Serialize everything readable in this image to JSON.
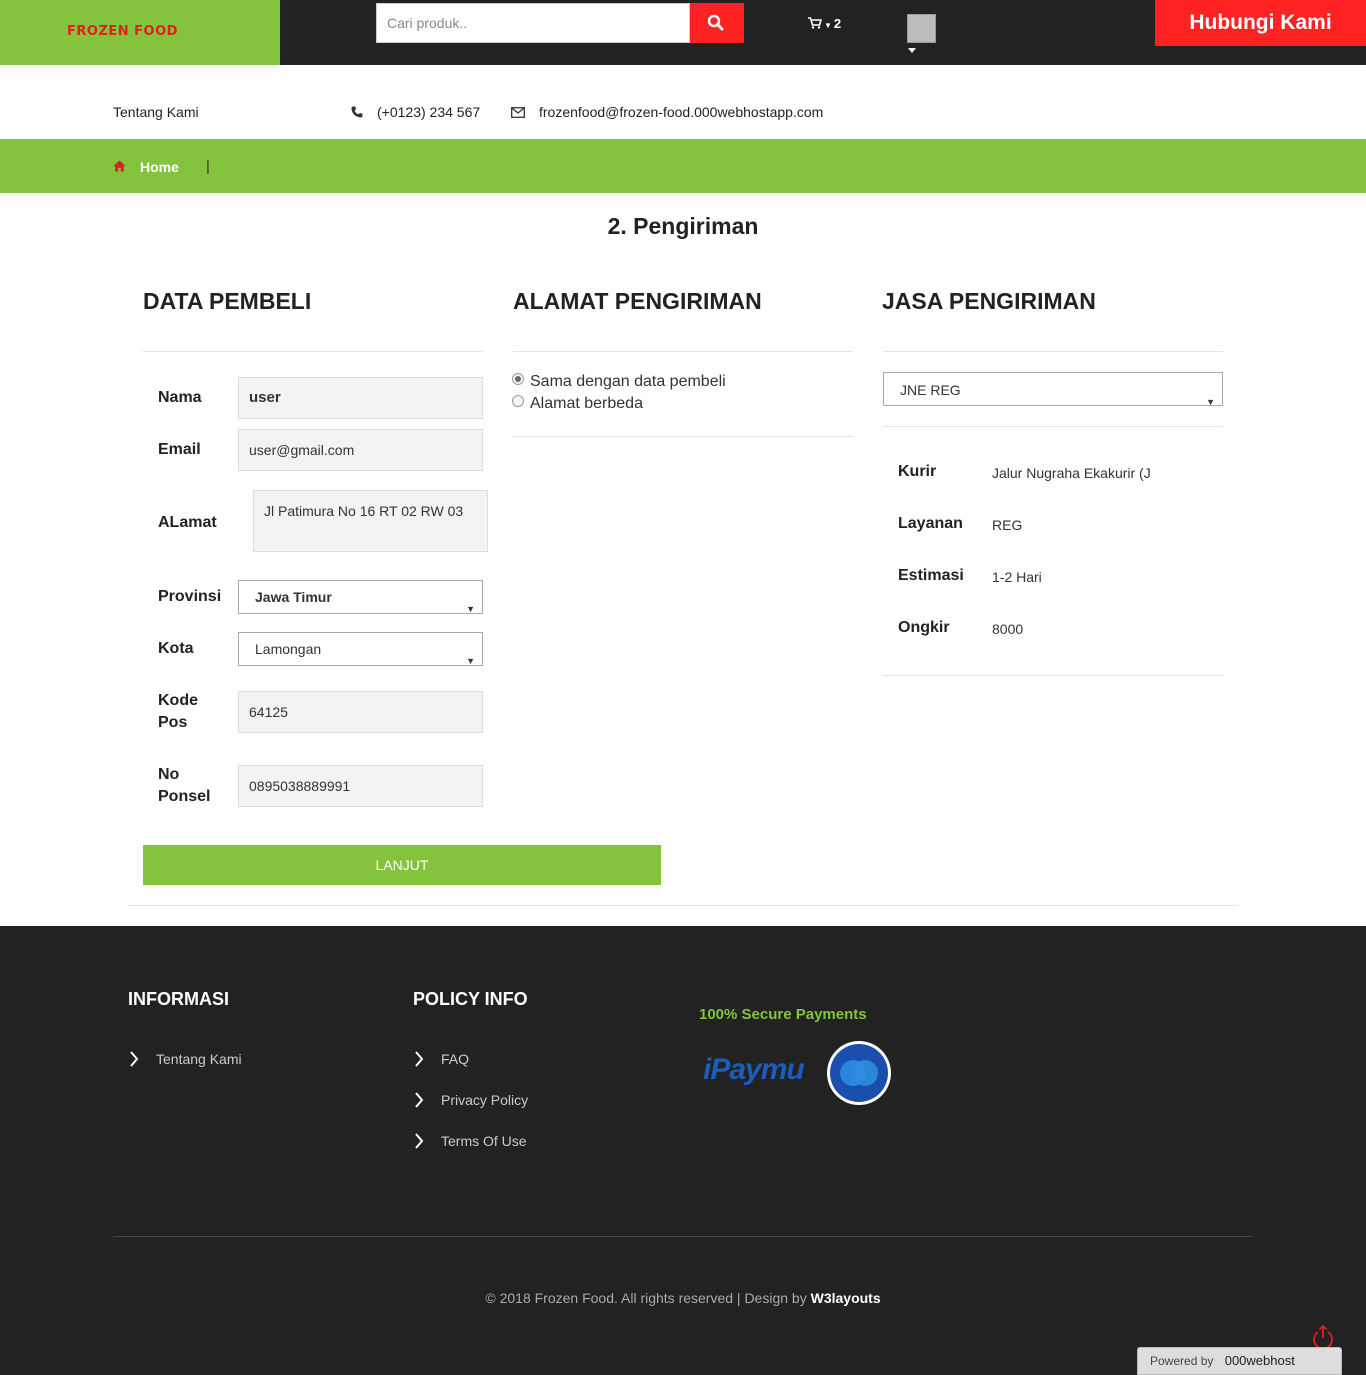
{
  "header": {
    "logo": "FROZEN FOOD",
    "search_placeholder": "Cari produk..",
    "cart_count": "2",
    "contact_label": "Hubungi Kami"
  },
  "info": {
    "about": "Tentang Kami",
    "phone": "(+0123) 234 567",
    "email": "frozenfood@frozen-food.000webhostapp.com"
  },
  "breadcrumb": {
    "home": "Home",
    "separator": "|"
  },
  "page": {
    "title": "2. Pengiriman"
  },
  "buyer": {
    "title": "DATA PEMBELI",
    "name_label": "Nama",
    "name_value": "user",
    "email_label": "Email",
    "email_value": "user@gmail.com",
    "address_label": "ALamat",
    "address_value": "Jl Patimura No 16 RT 02 RW 03",
    "province_label": "Provinsi",
    "province_value": "Jawa Timur",
    "city_label": "Kota",
    "city_value": "Lamongan",
    "zip_label_1": "Kode",
    "zip_label_2": "Pos",
    "zip_value": "64125",
    "phone_label_1": "No",
    "phone_label_2": "Ponsel",
    "phone_value": "0895038889991"
  },
  "shipping_address": {
    "title": "ALAMAT PENGIRIMAN",
    "option_same": "Sama dengan data pembeli",
    "option_diff": "Alamat berbeda",
    "selected": "same"
  },
  "shipping_service": {
    "title": "JASA PENGIRIMAN",
    "selected": "JNE REG",
    "courier_label": "Kurir",
    "courier_value": "Jalur Nugraha Ekakurir (J",
    "service_label": "Layanan",
    "service_value": "REG",
    "estimate_label": "Estimasi",
    "estimate_value": "1-2 Hari",
    "cost_label": "Ongkir",
    "cost_value": "8000"
  },
  "actions": {
    "next": "LANJUT"
  },
  "footer": {
    "info_title": "INFORMASI",
    "info_links": [
      "Tentang Kami"
    ],
    "policy_title": "POLICY INFO",
    "policy_links": [
      "FAQ",
      "Privacy Policy",
      "Terms Of Use"
    ],
    "secure_label": "100% Secure Payments",
    "payment_logo": "iPaymu",
    "copyright": "© 2018 Frozen Food. All rights reserved | Design by",
    "designer": "W3layouts",
    "powered_by": "Powered by",
    "host": "000webhost"
  },
  "colors": {
    "green": "#84c43c",
    "red": "#ff2222",
    "dark": "#222222"
  },
  "icons": [
    "search-icon",
    "cart-icon",
    "phone-icon",
    "envelope-icon",
    "home-icon",
    "chevron-right-icon",
    "power-icon"
  ]
}
